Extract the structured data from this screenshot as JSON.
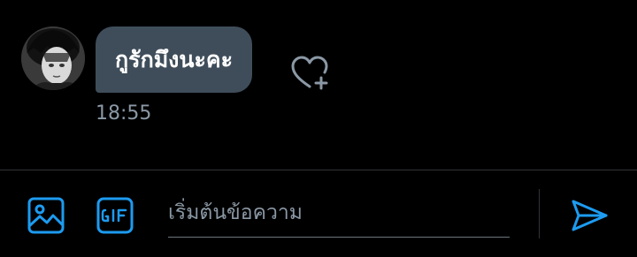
{
  "conversation": {
    "messages": [
      {
        "text": "กูรักมึงนะคะ",
        "time": "18:55"
      }
    ]
  },
  "composer": {
    "placeholder": "เริ่มต้นข้อความ",
    "value": ""
  },
  "colors": {
    "background": "#000000",
    "bubble": "#3f4d5a",
    "accent": "#1d9bf0",
    "muted": "#8b98a5",
    "divider": "#2f3336"
  },
  "icons": {
    "avatar": "avatar",
    "react": "heart-plus-icon",
    "image": "image-icon",
    "gif": "gif-icon",
    "send": "send-icon"
  }
}
